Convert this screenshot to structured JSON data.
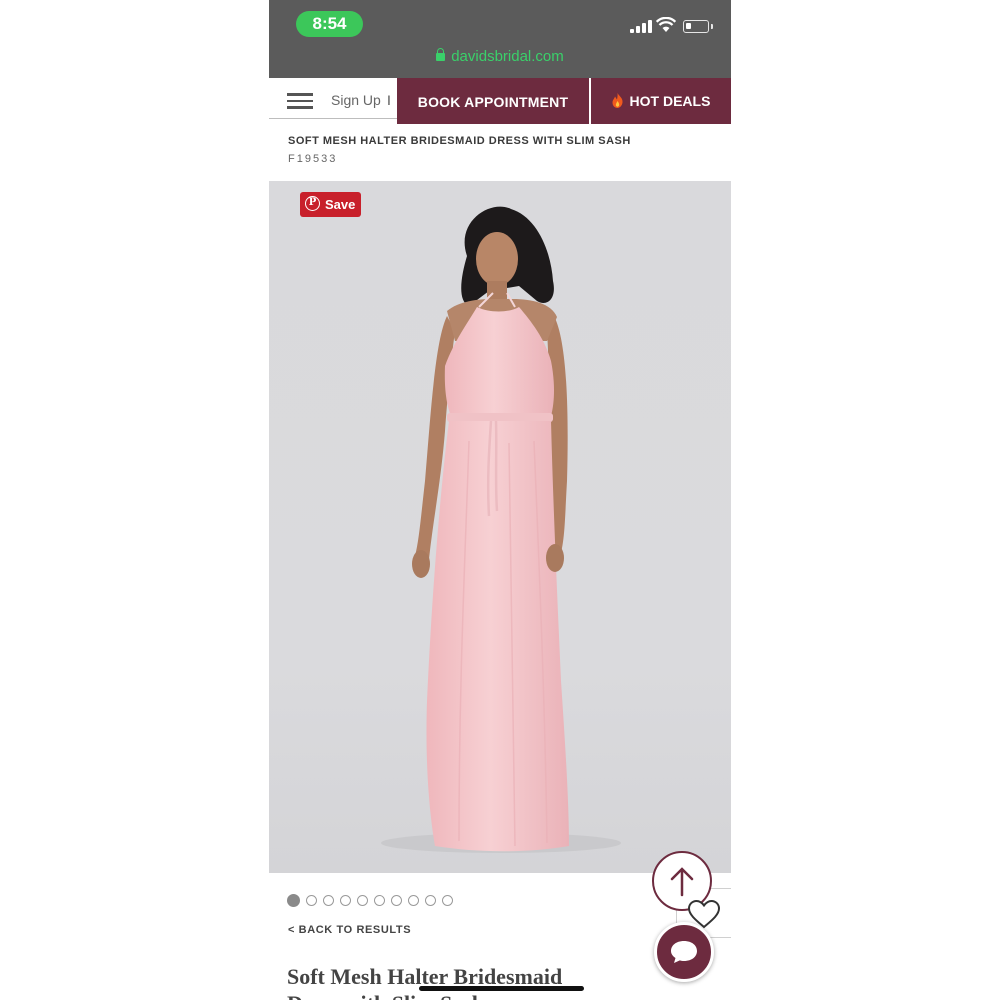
{
  "status_bar": {
    "time": "8:54",
    "url": "davidsbridal.com",
    "icons": [
      "signal-icon",
      "wifi-icon",
      "battery-icon"
    ]
  },
  "nav": {
    "menu_icon": "hamburger-icon",
    "signup_label": "Sign Up",
    "separator": "I",
    "book_label": "BOOK APPOINTMENT",
    "deals_label": "HOT DEALS",
    "deals_icon": "flame-icon",
    "accent_color": "#6d2b3f"
  },
  "product": {
    "header_title": "SOFT MESH HALTER BRIDESMAID DRESS WITH SLIM SASH",
    "sku": "F19533",
    "save_label": "Save",
    "image_count": 10,
    "active_image": 1,
    "back_label": "< BACK TO RESULTS",
    "display_title": "Soft Mesh Halter Bridesmaid Dress with Slim Sash",
    "dress_color": "#f4c4c8"
  },
  "floating": {
    "scroll_top_icon": "arrow-up-icon",
    "favorite_icon": "heart-icon",
    "chat_icon": "chat-bubble-icon"
  }
}
